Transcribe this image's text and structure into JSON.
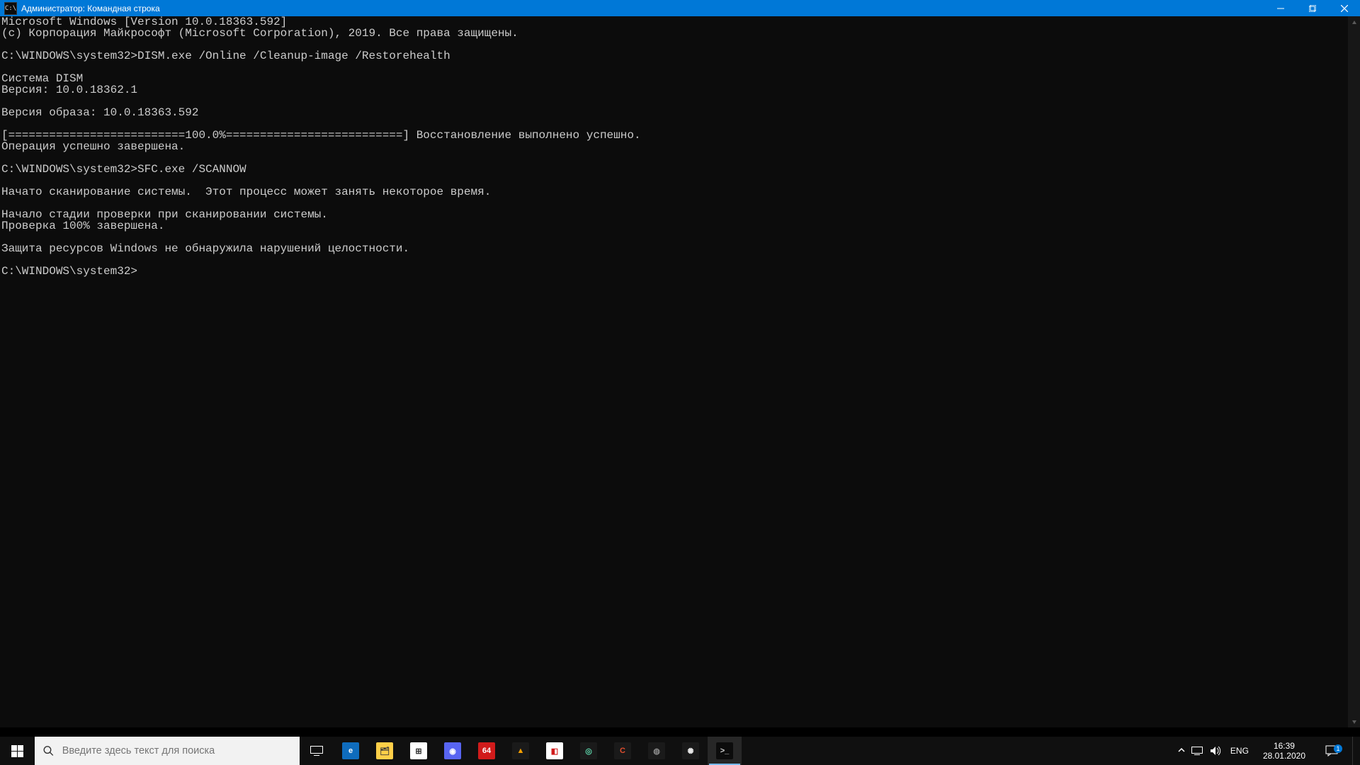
{
  "titlebar": {
    "prefix": "Администратор:",
    "title": "Командная строка",
    "icon_glyph": "C:\\"
  },
  "terminal": {
    "lines": [
      "Microsoft Windows [Version 10.0.18363.592]",
      "(c) Корпорация Майкрософт (Microsoft Corporation), 2019. Все права защищены.",
      "",
      "C:\\WINDOWS\\system32>DISM.exe /Online /Cleanup-image /Restorehealth",
      "",
      "Система DISM",
      "Версия: 10.0.18362.1",
      "",
      "Версия образа: 10.0.18363.592",
      "",
      "[==========================100.0%==========================] Восстановление выполнено успешно.",
      "Операция успешно завершена.",
      "",
      "C:\\WINDOWS\\system32>SFC.exe /SCANNOW",
      "",
      "Начато сканирование системы.  Этот процесс может занять некоторое время.",
      "",
      "Начало стадии проверки при сканировании системы.",
      "Проверка 100% завершена.",
      "",
      "Защита ресурсов Windows не обнаружила нарушений целостности.",
      "",
      "C:\\WINDOWS\\system32>"
    ]
  },
  "search": {
    "placeholder": "Введите здесь текст для поиска"
  },
  "taskbar_apps": [
    {
      "name": "edge",
      "label": "e",
      "bg": "#0f6cbd",
      "fg": "#ffffff"
    },
    {
      "name": "explorer",
      "label": "🗂",
      "bg": "#ffcf48",
      "fg": "#3a3a3a"
    },
    {
      "name": "store",
      "label": "⊞",
      "bg": "#ffffff",
      "fg": "#2c2c2c"
    },
    {
      "name": "discord",
      "label": "◉",
      "bg": "#5865f2",
      "fg": "#ffffff"
    },
    {
      "name": "aida64",
      "label": "64",
      "bg": "#d11b1b",
      "fg": "#ffffff"
    },
    {
      "name": "app-orange",
      "label": "▲",
      "bg": "#1a1a1a",
      "fg": "#f6a000"
    },
    {
      "name": "app-flag",
      "label": "◧",
      "bg": "#ffffff",
      "fg": "#d11b1b"
    },
    {
      "name": "app-globe",
      "label": "◎",
      "bg": "#1a1a1a",
      "fg": "#5bd1a7"
    },
    {
      "name": "ccleaner",
      "label": "C",
      "bg": "#1a1a1a",
      "fg": "#e04e2e"
    },
    {
      "name": "obs",
      "label": "◍",
      "bg": "#1a1a1a",
      "fg": "#8a8a8a"
    },
    {
      "name": "app-gear",
      "label": "✺",
      "bg": "#1a1a1a",
      "fg": "#e8e8e8"
    },
    {
      "name": "cmd",
      "label": ">_",
      "bg": "#0c0c0c",
      "fg": "#cfcfcf",
      "active": true
    }
  ],
  "tray": {
    "lang": "ENG",
    "time": "16:39",
    "date": "28.01.2020",
    "notif_count": "1"
  }
}
